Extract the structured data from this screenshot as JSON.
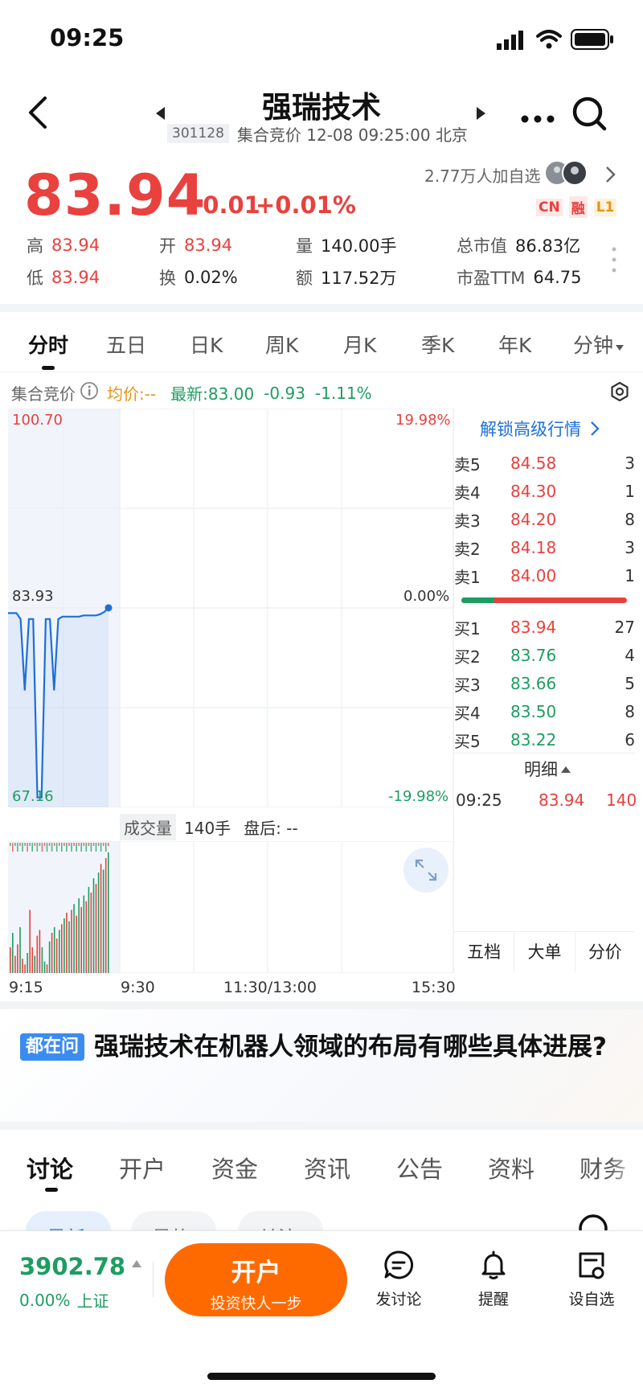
{
  "status_bar": {
    "time": "09:25"
  },
  "header": {
    "title": "强瑞技术",
    "code": "301128",
    "subtitle": "集合竞价 12-08 09:25:00 北京"
  },
  "quote": {
    "price": "83.94",
    "change": "+0.01",
    "change_pct": "+0.01%",
    "watchers": "2.77万人加自选",
    "badges": [
      "CN",
      "融",
      "L1"
    ],
    "stats": [
      {
        "label": "高",
        "value": "83.94"
      },
      {
        "label": "开",
        "value": "83.94"
      },
      {
        "label": "量",
        "value": "140.00手"
      },
      {
        "label": "总市值",
        "value": "86.83亿"
      },
      {
        "label": "低",
        "value": "83.94"
      },
      {
        "label": "换",
        "value": "0.02%"
      },
      {
        "label": "额",
        "value": "117.52万"
      },
      {
        "label": "市盈TTM",
        "value": "64.75"
      }
    ]
  },
  "chart_tabs": [
    "分时",
    "五日",
    "日K",
    "周K",
    "月K",
    "季K",
    "年K",
    "分钟"
  ],
  "info_bar": {
    "auction": "集合竞价",
    "avg": "均价:--",
    "latest": "最新:83.00",
    "latest_chg": "-0.93",
    "latest_pct": "-1.11%"
  },
  "chart": {
    "price_top": "100.70",
    "pct_top": "19.98%",
    "price_mid": "83.93",
    "pct_mid": "0.00%",
    "price_bottom": "67.16",
    "pct_bottom": "-19.98%",
    "volume_label": "成交量",
    "volume_value": "140手",
    "after_hours": "盘后: --",
    "time_labels": [
      "9:15",
      "9:30",
      "11:30/13:00",
      "15:30"
    ]
  },
  "chart_data": {
    "type": "line",
    "ylim": [
      67.16,
      100.7
    ],
    "series": [
      {
        "values": [
          83.5,
          83.5,
          83.5,
          83.0,
          77.0,
          83.0,
          83.0,
          68.0,
          68.0,
          83.0,
          83.0,
          77.0,
          83.0,
          83.2,
          83.2,
          83.2,
          83.2,
          83.2,
          83.3,
          83.3,
          83.3,
          83.3,
          83.4,
          83.6,
          83.94
        ]
      }
    ],
    "volume": {
      "values": [
        9,
        14,
        6,
        10,
        16,
        5,
        3,
        7,
        22,
        9,
        6,
        13,
        15,
        9,
        4,
        3,
        11,
        14,
        16,
        12,
        15,
        17,
        19,
        21,
        18,
        22,
        24,
        20,
        26,
        23,
        27,
        25,
        30,
        28,
        33,
        31,
        35,
        38,
        36,
        40,
        42
      ]
    }
  },
  "orderbook": {
    "unlock": "解锁高级行情",
    "asks": [
      {
        "label": "卖5",
        "price": "84.58",
        "vol": "3"
      },
      {
        "label": "卖4",
        "price": "84.30",
        "vol": "1"
      },
      {
        "label": "卖3",
        "price": "84.20",
        "vol": "8"
      },
      {
        "label": "卖2",
        "price": "84.18",
        "vol": "3"
      },
      {
        "label": "卖1",
        "price": "84.00",
        "vol": "1"
      }
    ],
    "bids": [
      {
        "label": "买1",
        "price": "83.94",
        "vol": "27"
      },
      {
        "label": "买2",
        "price": "83.76",
        "vol": "4"
      },
      {
        "label": "买3",
        "price": "83.66",
        "vol": "5"
      },
      {
        "label": "买4",
        "price": "83.50",
        "vol": "8"
      },
      {
        "label": "买5",
        "price": "83.22",
        "vol": "6"
      }
    ],
    "bid_share": 0.2,
    "detail_label": "明细",
    "trade": {
      "time": "09:25",
      "price": "83.94",
      "vol": "140"
    },
    "tabs": [
      "五档",
      "大单",
      "分价"
    ]
  },
  "question": {
    "tag": "都在问",
    "text": "强瑞技术在机器人领域的布局有哪些具体进展?"
  },
  "bottom_tabs": [
    "讨论",
    "开户",
    "资金",
    "资讯",
    "公告",
    "资料",
    "财务"
  ],
  "filter_chips": [
    "最新",
    "最热",
    "关注"
  ],
  "footer": {
    "index_value": "3902.78",
    "index_pct": "0.00%",
    "index_name": "上证",
    "open_main": "开户",
    "open_sub": "投资快人一步",
    "actions": [
      "发讨论",
      "提醒",
      "设自选"
    ]
  },
  "colors": {
    "up": "#e8413e",
    "down": "#1e9d62",
    "line": "#1e6fd9",
    "accent": "#ff6a00",
    "link": "#1e6fd9"
  }
}
